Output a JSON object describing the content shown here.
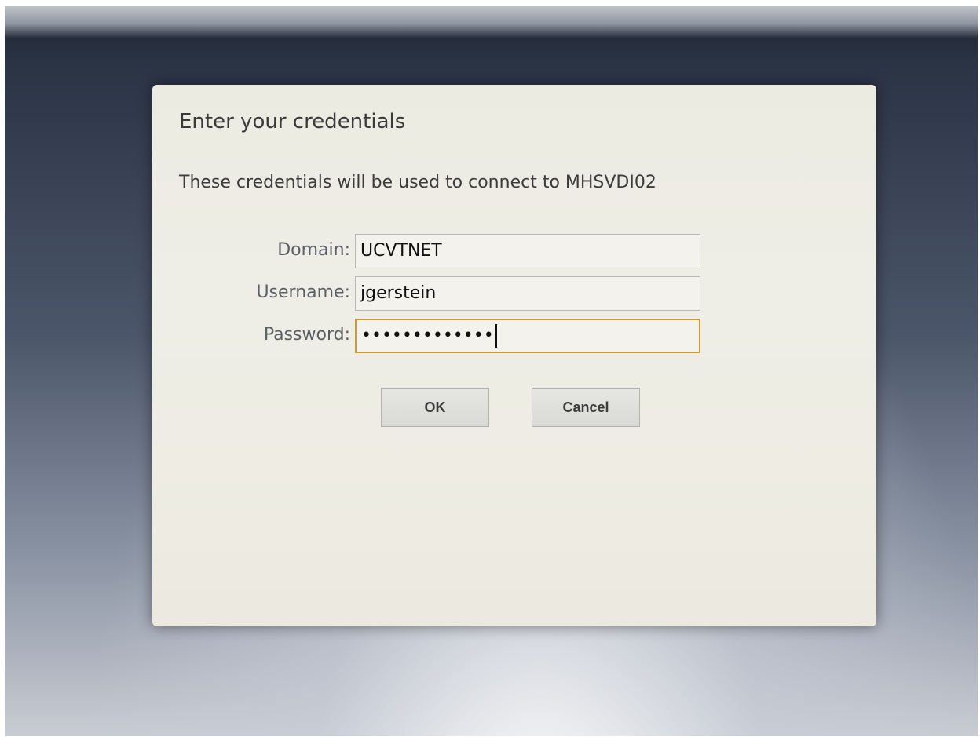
{
  "dialog": {
    "title": "Enter your credentials",
    "message": "These credentials will be used to connect to MHSVDI02",
    "fields": {
      "domain": {
        "label": "Domain:",
        "value": "UCVTNET"
      },
      "username": {
        "label": "Username:",
        "value": "jgerstein"
      },
      "password": {
        "label": "Password:",
        "value": "•••••••••••••"
      }
    },
    "buttons": {
      "ok": "OK",
      "cancel": "Cancel"
    }
  },
  "colors": {
    "dialog_background": "#efeee6",
    "focus_border": "#c89a3c"
  }
}
